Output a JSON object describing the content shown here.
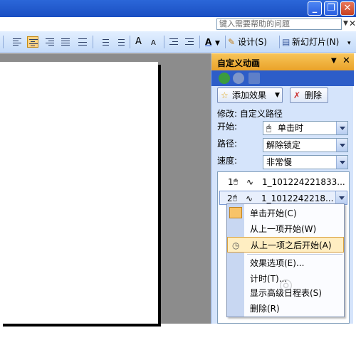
{
  "help": {
    "placeholder": "键入需要帮助的问题"
  },
  "toolbar": {
    "font_grow": "A",
    "font_shrink": "A",
    "font_color": "A",
    "design_label": "设计(S)",
    "new_slide_label": "新幻灯片(N)"
  },
  "task_pane": {
    "title": "自定义动画",
    "add_effect_label": "添加效果",
    "remove_label": "删除",
    "modify_label": "修改: 自定义路径",
    "start_label": "开始:",
    "start_value": "单击时",
    "path_label": "路径:",
    "path_value": "解除锁定",
    "speed_label": "速度:",
    "speed_value": "非常慢",
    "animations": [
      {
        "index": "1",
        "name": "1_101224221833..."
      },
      {
        "index": "2",
        "name": "1_1012242218..."
      }
    ]
  },
  "context_menu": {
    "items": [
      {
        "label": "单击开始(C)"
      },
      {
        "label": "从上一项开始(W)"
      },
      {
        "label": "从上一项之后开始(A)"
      },
      {
        "label": "效果选项(E)..."
      },
      {
        "label": "计时(T)..."
      },
      {
        "label": "显示高级日程表(S)"
      },
      {
        "label": "删除(R)"
      }
    ]
  },
  "colors": {
    "titlebar": "#1a4fc2",
    "pane_header": "#f0b23a",
    "pane_bg": "#d5e4fb",
    "menu_highlight": "#ffeec2"
  }
}
